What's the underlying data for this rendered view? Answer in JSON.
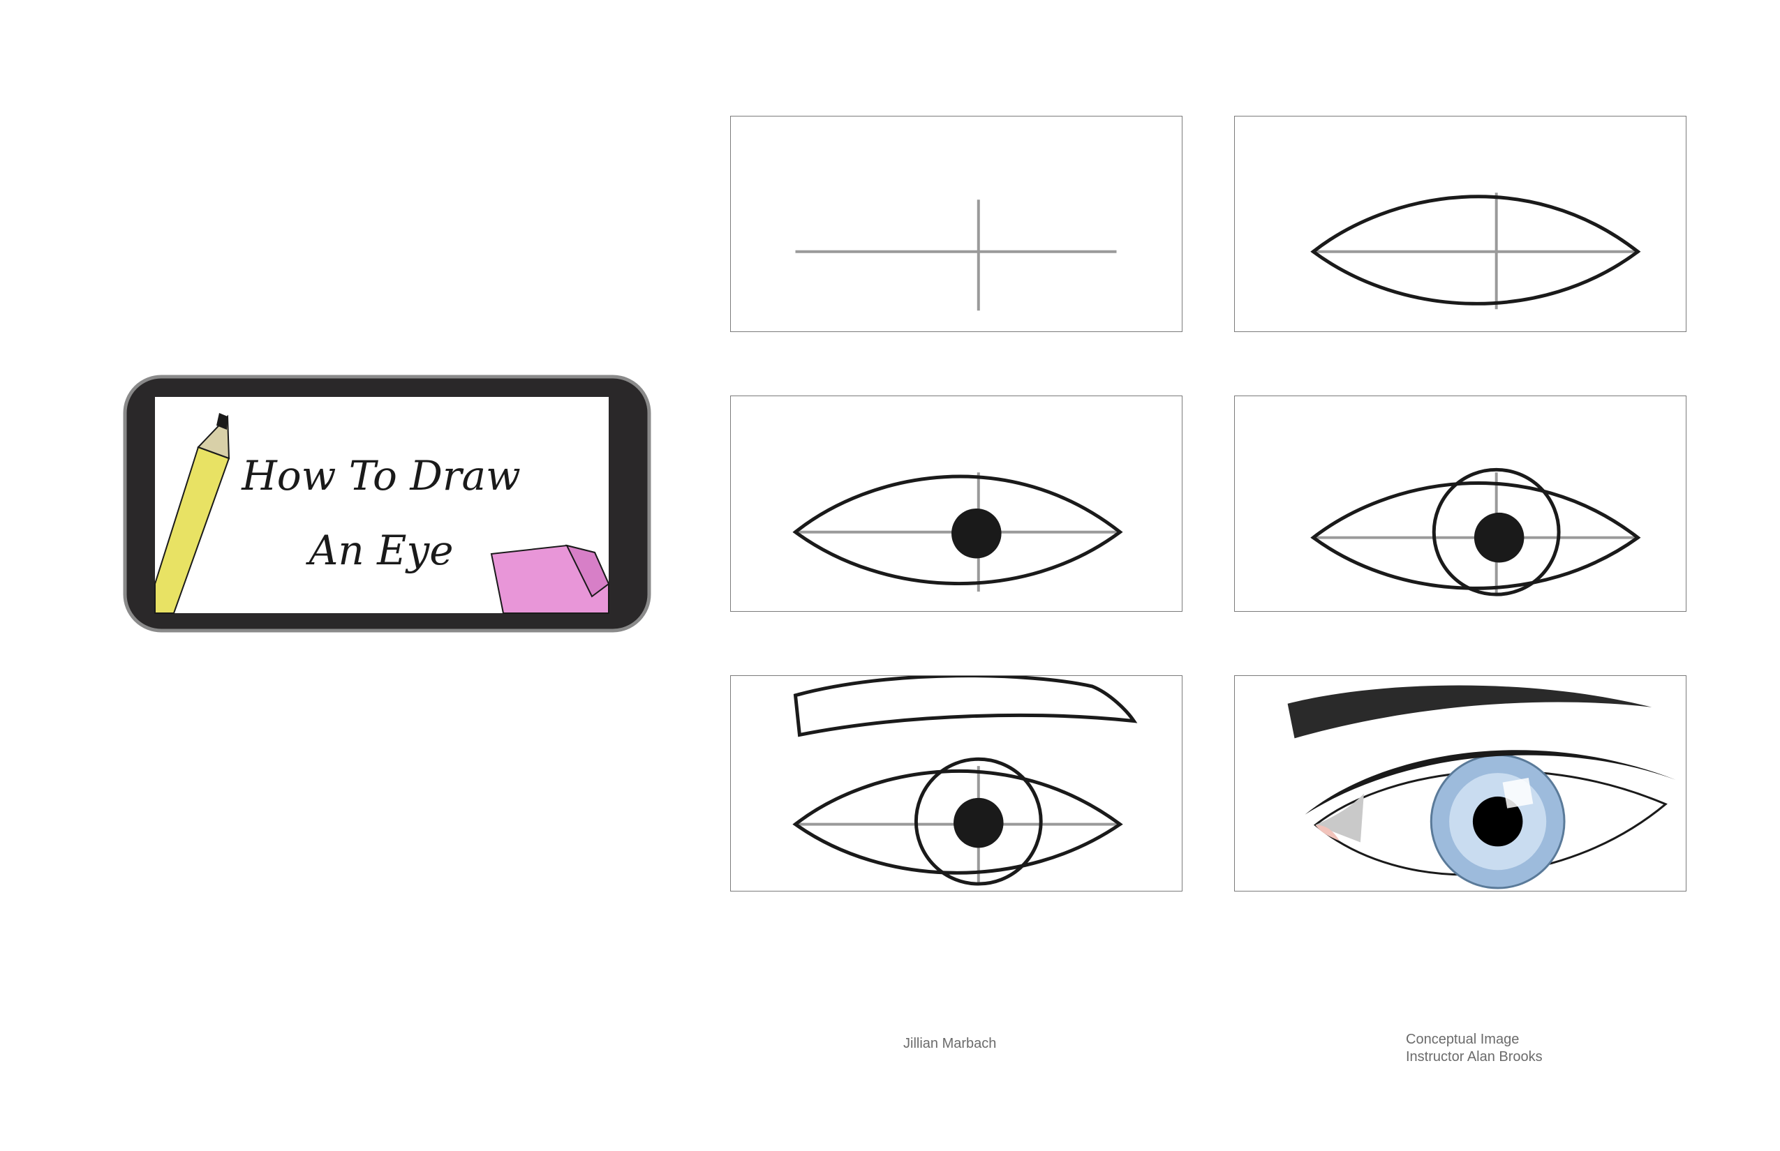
{
  "title_card": {
    "title_line_1": "How To Draw",
    "title_line_2": "An Eye",
    "frame_color": "#2a2829",
    "frame_border_color": "#8a8a8a",
    "pencil_color": "#e8e264",
    "eraser_color": "#e896d8"
  },
  "steps": [
    {
      "icon": "crosshair-guideline-icon"
    },
    {
      "icon": "eye-outline-icon"
    },
    {
      "icon": "eye-with-pupil-icon"
    },
    {
      "icon": "eye-with-iris-circle-icon"
    },
    {
      "icon": "eye-with-eyebrow-icon"
    },
    {
      "icon": "finished-blue-eye-icon"
    }
  ],
  "credits": {
    "student": "Jillian Marbach",
    "instructor_line_1": "Conceptual Image",
    "instructor_line_2": "Instructor Alan Brooks"
  },
  "colors": {
    "sketch_line": "#1a1a1a",
    "guide_line": "#9a9a9a",
    "iris_blue": "#9dbbdc",
    "credit_text": "#6b6b6b"
  }
}
